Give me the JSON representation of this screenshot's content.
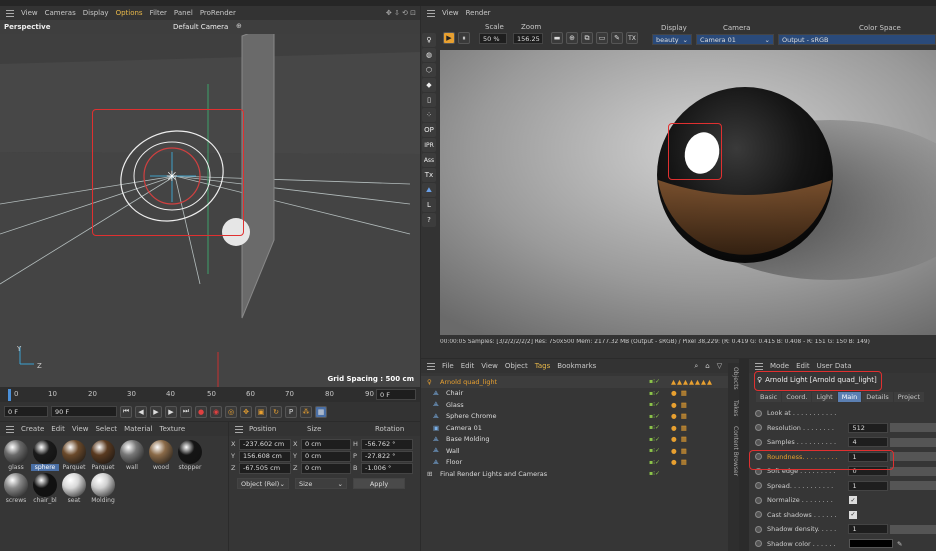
{
  "viewport": {
    "menu": [
      "View",
      "Cameras",
      "Display",
      "Options",
      "Filter",
      "Panel",
      "ProRender"
    ],
    "active_menu": "Options",
    "name": "Perspective",
    "camera": "Default Camera",
    "grid_spacing": "Grid Spacing : 500 cm"
  },
  "render_view": {
    "menu": [
      "View",
      "Render"
    ],
    "scale_label": "Scale",
    "zoom_label": "Zoom",
    "scale_value": "50 %",
    "zoom_value": "156.25",
    "display_label": "Display",
    "camera_label": "Camera",
    "colorspace_label": "Color Space",
    "display_value": "beauty",
    "camera_value": "Camera 01",
    "colorspace_value": "Output - sRGB",
    "status": "00:00:05  Samples: [3/2/2/2/2/2]  Res: 750x500  Mem: 2177.32 MB  (Output - sRGB) / Pixel 38,229: (R: 0.419 G: 0.415 B: 0.408 - R: 151 G: 150 B: 149)",
    "side_tools": [
      "OP",
      "IPR",
      "Ass",
      "Tx",
      "L",
      "?"
    ]
  },
  "timeline": {
    "ticks": [
      "0",
      "10",
      "20",
      "30",
      "40",
      "50",
      "60",
      "70",
      "80",
      "90"
    ],
    "frame_end_label": "0 F",
    "start_field": "0 F",
    "end_field": "90 F"
  },
  "materials": {
    "menu": [
      "Create",
      "Edit",
      "View",
      "Select",
      "Material",
      "Texture"
    ],
    "items": [
      {
        "name": "glass",
        "color": "#6a6a6a"
      },
      {
        "name": "sphere",
        "color": "#1a1a1a"
      },
      {
        "name": "Parquet",
        "color": "#6b4a2b"
      },
      {
        "name": "Parquet",
        "color": "#5a3a20"
      },
      {
        "name": "wall",
        "color": "#777"
      },
      {
        "name": "wood",
        "color": "#8a6a48"
      },
      {
        "name": "stopper",
        "color": "#151515"
      },
      {
        "name": "screws",
        "color": "#888"
      },
      {
        "name": "chair_bl",
        "color": "#111"
      },
      {
        "name": "seat",
        "color": "#d8d8d8"
      },
      {
        "name": "Molding",
        "color": "#d0d0d0"
      }
    ],
    "selected": "sphere"
  },
  "coords": {
    "headers": [
      "Position",
      "Size",
      "Rotation"
    ],
    "rows": [
      {
        "axis": "X",
        "pos": "-237.602 cm",
        "saxis": "X",
        "size": "0 cm",
        "raxis": "H",
        "rot": "-56.762 °"
      },
      {
        "axis": "Y",
        "pos": "156.608 cm",
        "saxis": "Y",
        "size": "0 cm",
        "raxis": "P",
        "rot": "-27.822 °"
      },
      {
        "axis": "Z",
        "pos": "-67.505 cm",
        "saxis": "Z",
        "size": "0 cm",
        "raxis": "B",
        "rot": "-1.006 °"
      }
    ],
    "mode": "Object (Rel)",
    "size_mode": "Size",
    "apply": "Apply"
  },
  "objects": {
    "menu": [
      "File",
      "Edit",
      "View",
      "Object",
      "Tags",
      "Bookmarks"
    ],
    "items": [
      {
        "name": "Arnold quad_light",
        "selected": true
      },
      {
        "name": "Chair",
        "selected": false
      },
      {
        "name": "Glass",
        "selected": false
      },
      {
        "name": "Sphere Chrome",
        "selected": false
      },
      {
        "name": "Camera 01",
        "selected": false
      },
      {
        "name": "Base Molding",
        "selected": false
      },
      {
        "name": "Wall",
        "selected": false
      },
      {
        "name": "Floor",
        "selected": false
      },
      {
        "name": "Final Render Lights and Cameras",
        "selected": false
      }
    ],
    "side_tabs": [
      "Objects",
      "Takes",
      "Content Browser"
    ]
  },
  "attributes": {
    "menu": [
      "Mode",
      "Edit",
      "User Data"
    ],
    "title": "Arnold Light [Arnold quad_light]",
    "tabs": [
      "Basic",
      "Coord.",
      "Light",
      "Main",
      "Details",
      "Project"
    ],
    "active_tab": "Main",
    "rows": [
      {
        "label": "Look at . . . . . . . . . . .",
        "value": ""
      },
      {
        "label": "Resolution . . . . . . . .",
        "value": "512"
      },
      {
        "label": "Samples . . . . . . . . . .",
        "value": "4"
      },
      {
        "label": "Roundness. . . . . . . . .",
        "value": "1"
      },
      {
        "label": "Soft edge . . . . . . . . .",
        "value": "0"
      },
      {
        "label": "Spread. . . . . . . . . . .",
        "value": "1"
      },
      {
        "label": "Normalize . . . . . . . .",
        "value": ""
      },
      {
        "label": "Cast shadows . . . . . .",
        "value": ""
      },
      {
        "label": "Shadow density. . . . .",
        "value": "1"
      },
      {
        "label": "Shadow color . . . . . .",
        "value": ""
      }
    ]
  }
}
